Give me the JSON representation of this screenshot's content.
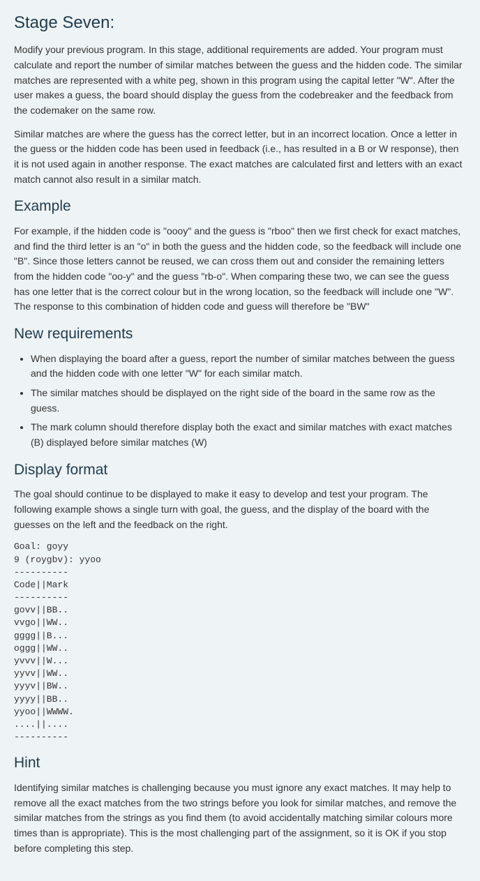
{
  "title": "Stage Seven:",
  "intro_p1": "Modify your previous program. In this stage, additional requirements are added. Your program must calculate and report the number of similar matches between the guess and the hidden code.  The similar matches are represented with a white peg, shown in this program using the capital letter \"W\".  After the user makes a guess, the board should display the guess from the codebreaker and the feedback from the codemaker on the same row.",
  "intro_p2": "Similar matches are where the guess has the correct letter, but in an incorrect location.  Once a letter in the guess or the hidden code has been used in feedback (i.e., has resulted in a B or W response), then it is not used again in another response.  The exact matches are calculated first and letters with an exact match cannot also result in a similar match.",
  "example_heading": "Example",
  "example_p": "For example, if the hidden code is \"oooy\" and the guess is \"rboo\" then we first check for exact matches, and find the third letter is an \"o\" in both the guess and the hidden code, so the feedback will include one \"B\". Since those letters cannot be reused, we can cross them out and consider the remaining letters from the hidden code \"oo-y\" and the guess \"rb-o\". When comparing these two, we can see the guess has one letter that is the correct colour but in the wrong location, so the feedback will include one \"W\".  The response to this combination of hidden code and guess will therefore be \"BW\"",
  "newreq_heading": "New requirements",
  "req1": "When displaying the board after a guess, report the number of similar matches between the guess and the hidden code with one letter \"W\" for each similar match.",
  "req2": "The similar matches should be displayed on the right side of the board in the same row as the guess.",
  "req3": "The mark column should therefore display both the exact and similar matches with exact matches (B) displayed before similar matches (W)",
  "display_heading": "Display format",
  "display_p": "The goal should continue to be displayed to make it easy to develop and test your program.  The following example shows a single turn with goal, the guess, and the display of the board with the guesses on the left and the feedback on the right.",
  "code_block": "Goal: goyy\n9 (roygbv): yyoo\n----------\nCode||Mark\n----------\ngovv||BB..\nvvgo||WW..\ngggg||B...\noggg||WW..\nyvvv||W...\nyyvv||WW..\nyyyv||BW..\nyyyy||BB..\nyyoo||WWWW.\n....||....\n----------",
  "hint_heading": "Hint",
  "hint_p": "Identifying similar matches is challenging because you must ignore any exact matches. It may help to remove all the exact matches from the two strings before you look for similar matches, and remove the similar matches from the strings as you find them (to avoid accidentally matching similar colours more times than is appropriate). This is the most challenging part of the assignment, so it is OK if you stop before completing this step."
}
